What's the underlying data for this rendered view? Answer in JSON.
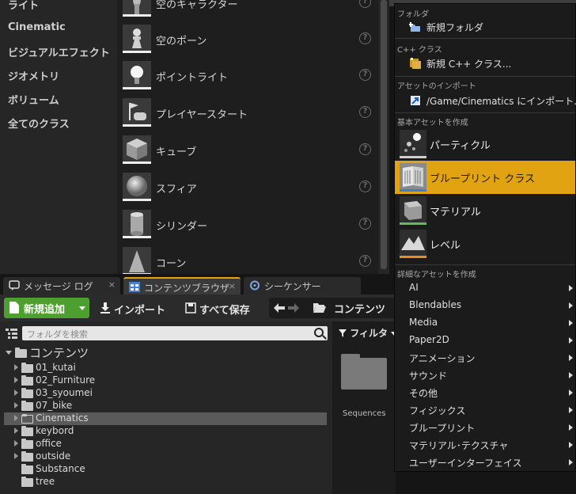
{
  "place_panel": {
    "categories": [
      "ライト",
      "Cinematic",
      "ビジュアルエフェクト",
      "ジオメトリ",
      "ボリューム",
      "全てのクラス"
    ],
    "actors": [
      {
        "label": "空のキャラクター",
        "icon": "character-icon"
      },
      {
        "label": "空のポーン",
        "icon": "pawn-icon"
      },
      {
        "label": "ポイントライト",
        "icon": "point-light-icon"
      },
      {
        "label": "プレイヤースタート",
        "icon": "player-start-icon"
      },
      {
        "label": "キューブ",
        "icon": "cube-icon"
      },
      {
        "label": "スフィア",
        "icon": "sphere-icon"
      },
      {
        "label": "シリンダー",
        "icon": "cylinder-icon"
      },
      {
        "label": "コーン",
        "icon": "cone-icon"
      }
    ],
    "help_glyph": "?"
  },
  "tabs": [
    {
      "label": "メッセージ ログ",
      "icon": "message-log-icon",
      "active": false
    },
    {
      "label": "コンテンツブラウザ",
      "icon": "content-browser-icon",
      "active": true
    },
    {
      "label": "シーケンサー",
      "icon": "sequencer-icon",
      "active": false
    }
  ],
  "tab_close_glyph": "×",
  "content_browser": {
    "add_new_label": "新規追加",
    "import_label": "インポート",
    "save_all_label": "すべて保存",
    "breadcrumb_root": "コンテンツ",
    "search_placeholder": "フォルダを検索",
    "filter_label": "フィルタ",
    "tree": [
      {
        "label": "コンテンツ",
        "level": 0,
        "expanded": true,
        "arrow": true
      },
      {
        "label": "01_kutai",
        "level": 1,
        "arrow": true
      },
      {
        "label": "02_Furniture",
        "level": 1,
        "arrow": true
      },
      {
        "label": "03_syoumei",
        "level": 1,
        "arrow": true
      },
      {
        "label": "07_bike",
        "level": 1,
        "arrow": true
      },
      {
        "label": "Cinematics",
        "level": 1,
        "arrow": true,
        "selected": true
      },
      {
        "label": "keybord",
        "level": 1,
        "arrow": true
      },
      {
        "label": "office",
        "level": 1,
        "arrow": true
      },
      {
        "label": "outside",
        "level": 1,
        "arrow": true
      },
      {
        "label": "Substance",
        "level": 1,
        "arrow": false
      },
      {
        "label": "tree",
        "level": 1,
        "arrow": false
      }
    ],
    "assets": [
      {
        "label": "Sequences",
        "icon": "folder-icon"
      }
    ]
  },
  "menu": {
    "sections": {
      "folder": "フォルダ",
      "cpp": "C++ クラス",
      "import": "アセットのインポート",
      "basic": "基本アセットを作成",
      "advanced": "詳細なアセットを作成"
    },
    "new_folder": "新規フォルダ",
    "new_cpp": "新規 C++ クラス...",
    "import_to": "/Game/Cinematics にインポート...",
    "basic_assets": [
      {
        "label": "パーティクル",
        "icon": "particle-icon",
        "bar": "#cfcfcf"
      },
      {
        "label": "ブループリント クラス",
        "icon": "blueprint-icon",
        "bar": "#3a7fd5",
        "highlighted": true
      },
      {
        "label": "マテリアル",
        "icon": "material-icon",
        "bar": "#55c255"
      },
      {
        "label": "レベル",
        "icon": "level-icon",
        "bar": "#f08a1c"
      }
    ],
    "advanced_items": [
      "AI",
      "Blendables",
      "Media",
      "Paper2D",
      "アニメーション",
      "サウンド",
      "その他",
      "フィジックス",
      "ブループリント",
      "マテリアル･テクスチャ",
      "ユーザーインターフェイス"
    ]
  },
  "colors": {
    "accent": "#e2a312",
    "add_new": "#4d9f30"
  }
}
